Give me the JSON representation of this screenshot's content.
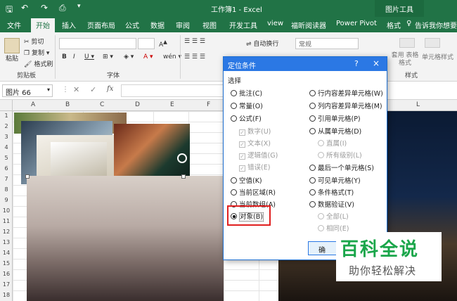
{
  "titlebar": {
    "doc_title": "工作簿1 - Excel",
    "context_tab": "图片工具"
  },
  "tabs": [
    "文件",
    "开始",
    "插入",
    "页面布局",
    "公式",
    "数据",
    "审阅",
    "视图",
    "开发工具",
    "view",
    "福昕阅读器",
    "Power Pivot",
    "格式"
  ],
  "tell_me": "告诉我你想要",
  "ribbon": {
    "cut": "剪切",
    "copy": "复制",
    "format_painter": "格式刷",
    "paste": "粘贴",
    "clipboard_group": "剪贴板",
    "font_group": "字体",
    "wrap_text": "自动换行",
    "number_format": "常规",
    "cell_styles": "单元格样式",
    "table_format": "套用\n表格格式",
    "styles_group": "样式"
  },
  "formula_bar": {
    "name_box": "图片 66",
    "fx": "fx"
  },
  "columns": [
    "A",
    "B",
    "C",
    "D",
    "E",
    "F",
    "L"
  ],
  "rows": [
    "1",
    "2",
    "3",
    "4",
    "5",
    "6",
    "7",
    "8",
    "9",
    "10",
    "11",
    "12",
    "13",
    "14",
    "15",
    "16",
    "17",
    "18"
  ],
  "dialog": {
    "title": "定位条件",
    "help": "?",
    "close": "×",
    "section": "选择",
    "left_options": [
      {
        "label": "批注(C)",
        "state": "off"
      },
      {
        "label": "常量(O)",
        "state": "off"
      },
      {
        "label": "公式(F)",
        "state": "off"
      },
      {
        "label": "数字(U)",
        "state": "sub"
      },
      {
        "label": "文本(X)",
        "state": "sub"
      },
      {
        "label": "逻辑值(G)",
        "state": "sub"
      },
      {
        "label": "错误(E)",
        "state": "sub"
      },
      {
        "label": "空值(K)",
        "state": "off"
      },
      {
        "label": "当前区域(R)",
        "state": "off"
      },
      {
        "label": "当前数组(A)",
        "state": "off"
      },
      {
        "label": "对象(B)",
        "state": "on"
      }
    ],
    "right_options": [
      {
        "label": "行内容差异单元格(W)",
        "state": "off"
      },
      {
        "label": "列内容差异单元格(M)",
        "state": "off"
      },
      {
        "label": "引用单元格(P)",
        "state": "off"
      },
      {
        "label": "从属单元格(D)",
        "state": "off"
      },
      {
        "label": "直属(I)",
        "state": "subradio"
      },
      {
        "label": "所有级别(L)",
        "state": "subradio"
      },
      {
        "label": "最后一个单元格(S)",
        "state": "off"
      },
      {
        "label": "可见单元格(Y)",
        "state": "off"
      },
      {
        "label": "条件格式(T)",
        "state": "off"
      },
      {
        "label": "数据验证(V)",
        "state": "off"
      },
      {
        "label": "全部(L)",
        "state": "subradio"
      },
      {
        "label": "相同(E)",
        "state": "subradio"
      }
    ],
    "ok": "确"
  },
  "watermark": {
    "title": "百科全说",
    "subtitle": "助你轻松解决"
  },
  "colors": {
    "excel_green": "#217346",
    "dialog_blue": "#2b78e4",
    "highlight_red": "#e02020",
    "watermark_green": "#1aa64a"
  }
}
